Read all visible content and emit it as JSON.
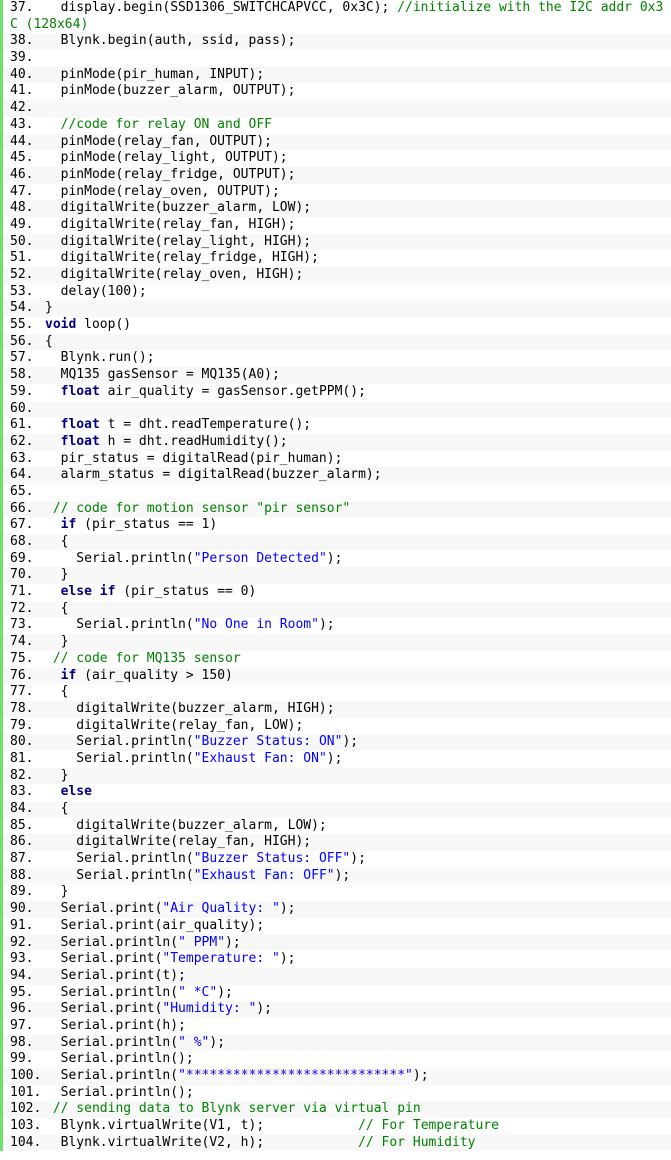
{
  "colors": {
    "gutter_bar": "#6ce26c",
    "keyword": "#000080",
    "comment": "#008200",
    "string": "#0000ff",
    "text": "#000000",
    "alt_row": "#f8f8f8"
  },
  "lines": [
    {
      "num": "37.",
      "tokens": [
        [
          "t",
          "  display.begin(SSD1306_SWITCHCAPVCC, 0x3C); "
        ],
        [
          "c",
          "//initialize with the I2C addr 0x3C (128x64)"
        ]
      ]
    },
    {
      "num": "38.",
      "tokens": [
        [
          "t",
          "  Blynk.begin(auth, ssid, pass);"
        ]
      ]
    },
    {
      "num": "39.",
      "tokens": []
    },
    {
      "num": "40.",
      "tokens": [
        [
          "t",
          "  pinMode(pir_human, INPUT);"
        ]
      ]
    },
    {
      "num": "41.",
      "tokens": [
        [
          "t",
          "  pinMode(buzzer_alarm, OUTPUT);"
        ]
      ]
    },
    {
      "num": "42.",
      "tokens": []
    },
    {
      "num": "43.",
      "tokens": [
        [
          "c",
          "  //code for relay ON and OFF"
        ]
      ]
    },
    {
      "num": "44.",
      "tokens": [
        [
          "t",
          "  pinMode(relay_fan, OUTPUT);"
        ]
      ]
    },
    {
      "num": "45.",
      "tokens": [
        [
          "t",
          "  pinMode(relay_light, OUTPUT);"
        ]
      ]
    },
    {
      "num": "46.",
      "tokens": [
        [
          "t",
          "  pinMode(relay_fridge, OUTPUT);"
        ]
      ]
    },
    {
      "num": "47.",
      "tokens": [
        [
          "t",
          "  pinMode(relay_oven, OUTPUT);"
        ]
      ]
    },
    {
      "num": "48.",
      "tokens": [
        [
          "t",
          "  digitalWrite(buzzer_alarm, LOW);"
        ]
      ]
    },
    {
      "num": "49.",
      "tokens": [
        [
          "t",
          "  digitalWrite(relay_fan, HIGH);"
        ]
      ]
    },
    {
      "num": "50.",
      "tokens": [
        [
          "t",
          "  digitalWrite(relay_light, HIGH);"
        ]
      ]
    },
    {
      "num": "51.",
      "tokens": [
        [
          "t",
          "  digitalWrite(relay_fridge, HIGH);"
        ]
      ]
    },
    {
      "num": "52.",
      "tokens": [
        [
          "t",
          "  digitalWrite(relay_oven, HIGH);"
        ]
      ]
    },
    {
      "num": "53.",
      "tokens": [
        [
          "t",
          "  delay(100);"
        ]
      ]
    },
    {
      "num": "54.",
      "tokens": [
        [
          "t",
          "}"
        ]
      ]
    },
    {
      "num": "55.",
      "tokens": [
        [
          "k",
          "void"
        ],
        [
          "t",
          " loop()"
        ]
      ]
    },
    {
      "num": "56.",
      "tokens": [
        [
          "t",
          "{"
        ]
      ]
    },
    {
      "num": "57.",
      "tokens": [
        [
          "t",
          "  Blynk.run();"
        ]
      ]
    },
    {
      "num": "58.",
      "tokens": [
        [
          "t",
          "  MQ135 gasSensor = MQ135(A0);"
        ]
      ]
    },
    {
      "num": "59.",
      "tokens": [
        [
          "t",
          "  "
        ],
        [
          "k",
          "float"
        ],
        [
          "t",
          " air_quality = gasSensor.getPPM();"
        ]
      ]
    },
    {
      "num": "60.",
      "tokens": []
    },
    {
      "num": "61.",
      "tokens": [
        [
          "t",
          "  "
        ],
        [
          "k",
          "float"
        ],
        [
          "t",
          " t = dht.readTemperature();"
        ]
      ]
    },
    {
      "num": "62.",
      "tokens": [
        [
          "t",
          "  "
        ],
        [
          "k",
          "float"
        ],
        [
          "t",
          " h = dht.readHumidity();"
        ]
      ]
    },
    {
      "num": "63.",
      "tokens": [
        [
          "t",
          "  pir_status = digitalRead(pir_human);"
        ]
      ]
    },
    {
      "num": "64.",
      "tokens": [
        [
          "t",
          "  alarm_status = digitalRead(buzzer_alarm);"
        ]
      ]
    },
    {
      "num": "65.",
      "tokens": []
    },
    {
      "num": "66.",
      "tokens": [
        [
          "c",
          " // code for motion sensor \"pir sensor\""
        ]
      ]
    },
    {
      "num": "67.",
      "tokens": [
        [
          "t",
          "  "
        ],
        [
          "k",
          "if"
        ],
        [
          "t",
          " (pir_status == 1)"
        ]
      ]
    },
    {
      "num": "68.",
      "tokens": [
        [
          "t",
          "  {"
        ]
      ]
    },
    {
      "num": "69.",
      "tokens": [
        [
          "t",
          "    Serial.println("
        ],
        [
          "s",
          "\"Person Detected\""
        ],
        [
          "t",
          ");"
        ]
      ]
    },
    {
      "num": "70.",
      "tokens": [
        [
          "t",
          "  }"
        ]
      ]
    },
    {
      "num": "71.",
      "tokens": [
        [
          "t",
          "  "
        ],
        [
          "k",
          "else if"
        ],
        [
          "t",
          " (pir_status == 0)"
        ]
      ]
    },
    {
      "num": "72.",
      "tokens": [
        [
          "t",
          "  {"
        ]
      ]
    },
    {
      "num": "73.",
      "tokens": [
        [
          "t",
          "    Serial.println("
        ],
        [
          "s",
          "\"No One in Room\""
        ],
        [
          "t",
          ");"
        ]
      ]
    },
    {
      "num": "74.",
      "tokens": [
        [
          "t",
          "  }"
        ]
      ]
    },
    {
      "num": "75.",
      "tokens": [
        [
          "c",
          " // code for MQ135 sensor"
        ]
      ]
    },
    {
      "num": "76.",
      "tokens": [
        [
          "t",
          "  "
        ],
        [
          "k",
          "if"
        ],
        [
          "t",
          " (air_quality > 150)"
        ]
      ]
    },
    {
      "num": "77.",
      "tokens": [
        [
          "t",
          "  {"
        ]
      ]
    },
    {
      "num": "78.",
      "tokens": [
        [
          "t",
          "    digitalWrite(buzzer_alarm, HIGH);"
        ]
      ]
    },
    {
      "num": "79.",
      "tokens": [
        [
          "t",
          "    digitalWrite(relay_fan, LOW);"
        ]
      ]
    },
    {
      "num": "80.",
      "tokens": [
        [
          "t",
          "    Serial.println("
        ],
        [
          "s",
          "\"Buzzer Status: ON\""
        ],
        [
          "t",
          ");"
        ]
      ]
    },
    {
      "num": "81.",
      "tokens": [
        [
          "t",
          "    Serial.println("
        ],
        [
          "s",
          "\"Exhaust Fan: ON\""
        ],
        [
          "t",
          ");"
        ]
      ]
    },
    {
      "num": "82.",
      "tokens": [
        [
          "t",
          "  }"
        ]
      ]
    },
    {
      "num": "83.",
      "tokens": [
        [
          "t",
          "  "
        ],
        [
          "k",
          "else"
        ]
      ]
    },
    {
      "num": "84.",
      "tokens": [
        [
          "t",
          "  {"
        ]
      ]
    },
    {
      "num": "85.",
      "tokens": [
        [
          "t",
          "    digitalWrite(buzzer_alarm, LOW);"
        ]
      ]
    },
    {
      "num": "86.",
      "tokens": [
        [
          "t",
          "    digitalWrite(relay_fan, HIGH);"
        ]
      ]
    },
    {
      "num": "87.",
      "tokens": [
        [
          "t",
          "    Serial.println("
        ],
        [
          "s",
          "\"Buzzer Status: OFF\""
        ],
        [
          "t",
          ");"
        ]
      ]
    },
    {
      "num": "88.",
      "tokens": [
        [
          "t",
          "    Serial.println("
        ],
        [
          "s",
          "\"Exhaust Fan: OFF\""
        ],
        [
          "t",
          ");"
        ]
      ]
    },
    {
      "num": "89.",
      "tokens": [
        [
          "t",
          "  }"
        ]
      ]
    },
    {
      "num": "90.",
      "tokens": [
        [
          "t",
          "  Serial.print("
        ],
        [
          "s",
          "\"Air Quality: \""
        ],
        [
          "t",
          ");"
        ]
      ]
    },
    {
      "num": "91.",
      "tokens": [
        [
          "t",
          "  Serial.print(air_quality);"
        ]
      ]
    },
    {
      "num": "92.",
      "tokens": [
        [
          "t",
          "  Serial.println("
        ],
        [
          "s",
          "\" PPM\""
        ],
        [
          "t",
          ");"
        ]
      ]
    },
    {
      "num": "93.",
      "tokens": [
        [
          "t",
          "  Serial.print("
        ],
        [
          "s",
          "\"Temperature: \""
        ],
        [
          "t",
          ");"
        ]
      ]
    },
    {
      "num": "94.",
      "tokens": [
        [
          "t",
          "  Serial.print(t);"
        ]
      ]
    },
    {
      "num": "95.",
      "tokens": [
        [
          "t",
          "  Serial.println("
        ],
        [
          "s",
          "\" *C\""
        ],
        [
          "t",
          ");"
        ]
      ]
    },
    {
      "num": "96.",
      "tokens": [
        [
          "t",
          "  Serial.print("
        ],
        [
          "s",
          "\"Humidity: \""
        ],
        [
          "t",
          ");"
        ]
      ]
    },
    {
      "num": "97.",
      "tokens": [
        [
          "t",
          "  Serial.print(h);"
        ]
      ]
    },
    {
      "num": "98.",
      "tokens": [
        [
          "t",
          "  Serial.println("
        ],
        [
          "s",
          "\" %\""
        ],
        [
          "t",
          ");"
        ]
      ]
    },
    {
      "num": "99.",
      "tokens": [
        [
          "t",
          "  Serial.println();"
        ]
      ]
    },
    {
      "num": "100.",
      "tokens": [
        [
          "t",
          "  Serial.println("
        ],
        [
          "s",
          "\"****************************\""
        ],
        [
          "t",
          ");"
        ]
      ]
    },
    {
      "num": "101.",
      "tokens": [
        [
          "t",
          "  Serial.println();"
        ]
      ]
    },
    {
      "num": "102.",
      "tokens": [
        [
          "c",
          " // sending data to Blynk server via virtual pin"
        ]
      ]
    },
    {
      "num": "103.",
      "tokens": [
        [
          "t",
          "  Blynk.virtualWrite(V1, t);            "
        ],
        [
          "c",
          "// For Temperature"
        ]
      ]
    },
    {
      "num": "104.",
      "tokens": [
        [
          "t",
          "  Blynk.virtualWrite(V2, h);            "
        ],
        [
          "c",
          "// For Humidity"
        ]
      ]
    }
  ]
}
